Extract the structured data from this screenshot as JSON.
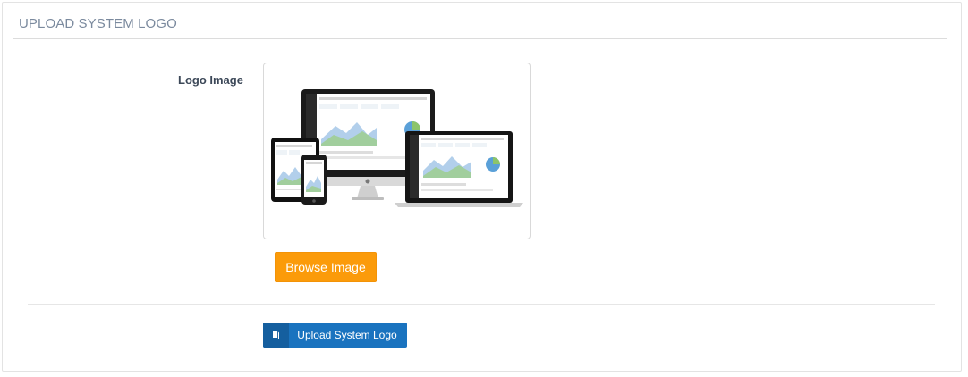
{
  "panel": {
    "title": "UPLOAD SYSTEM LOGO"
  },
  "form": {
    "logo_label": "Logo Image",
    "logo_preview_icon": "responsive-devices-image",
    "browse_label": "Browse Image",
    "upload_label": "Upload System Logo",
    "upload_icon": "book-icon"
  },
  "colors": {
    "browse_button": "#fb9b0a",
    "upload_button": "#1a73bf",
    "title_text": "#7b8a9e"
  }
}
